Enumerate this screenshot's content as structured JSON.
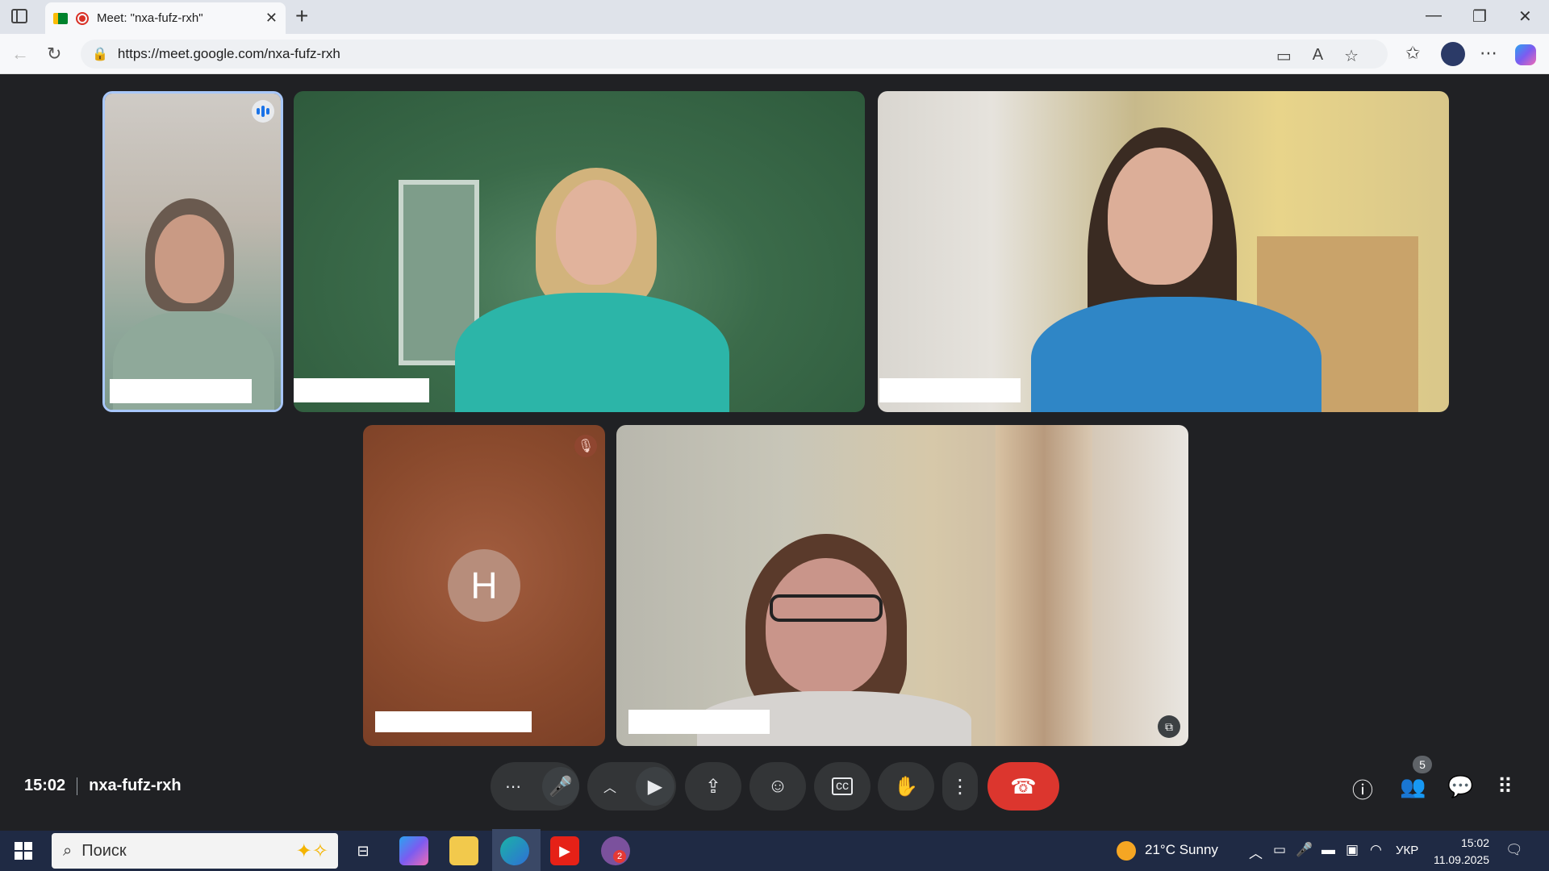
{
  "browser": {
    "tab_title": "Meet: \"nxa-fufz-rxh\"",
    "url": "https://meet.google.com/nxa-fufz-rxh"
  },
  "meet": {
    "participants": [
      {
        "avatar_letter": ""
      },
      {
        "avatar_letter": ""
      },
      {
        "avatar_letter": ""
      },
      {
        "avatar_letter": "H"
      },
      {
        "avatar_letter": ""
      }
    ],
    "time": "15:02",
    "meeting_code": "nxa-fufz-rxh",
    "people_count": "5"
  },
  "taskbar": {
    "search_placeholder": "Поиск",
    "weather": "21°C Sunny",
    "language": "УКР",
    "clock_time": "15:02",
    "clock_date": "11.09.2025",
    "viber_badge": "2"
  },
  "colors": {
    "hangup": "#dc362e",
    "speaking_border": "#a8c7fa",
    "meet_bg": "#202124"
  }
}
